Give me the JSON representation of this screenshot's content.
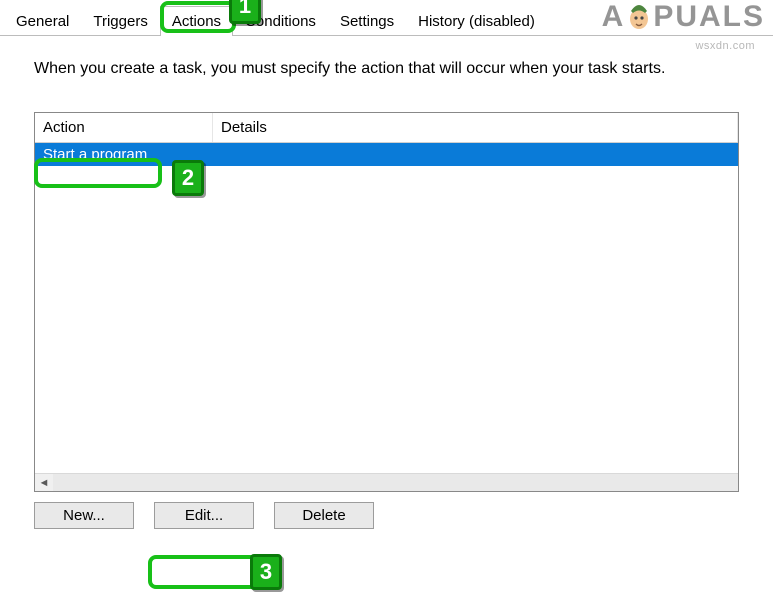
{
  "tabs": {
    "general": "General",
    "triggers": "Triggers",
    "actions": "Actions",
    "conditions": "Conditions",
    "settings": "Settings",
    "history": "History (disabled)",
    "active": "actions"
  },
  "description": "When you create a task, you must specify the action that will occur when your task starts.",
  "columns": {
    "action": "Action",
    "details": "Details"
  },
  "rows": [
    {
      "action": "Start a program",
      "details": "",
      "selected": true
    }
  ],
  "buttons": {
    "new": "New...",
    "edit": "Edit...",
    "delete": "Delete"
  },
  "annotations": {
    "one": "1",
    "two": "2",
    "three": "3"
  },
  "watermark": {
    "left": "A",
    "right": "PUALS",
    "sub": "wsxdn.com"
  }
}
